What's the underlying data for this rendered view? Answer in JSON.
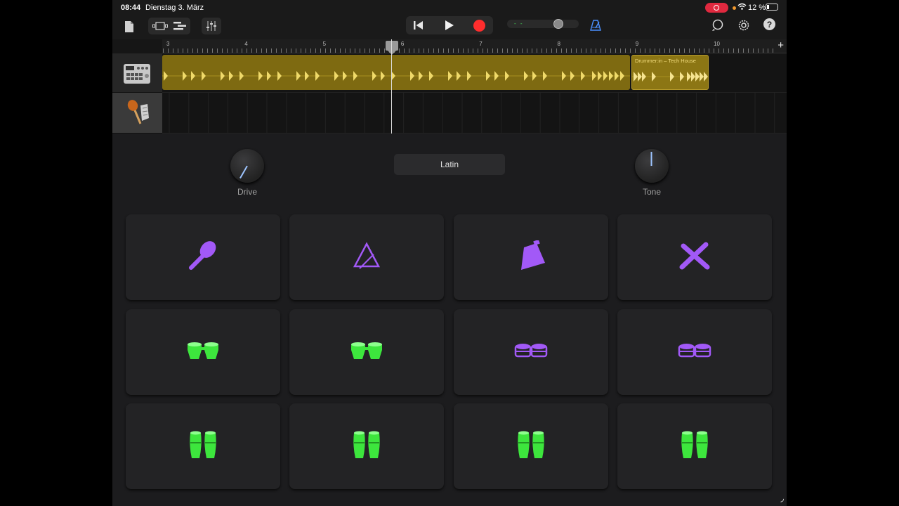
{
  "status_bar": {
    "time": "08:44",
    "date": "Dienstag 3. März",
    "battery_percent": "12 %"
  },
  "toolbar": {
    "lcd_readout": "- -"
  },
  "ruler": {
    "bars": [
      "3",
      "4",
      "5",
      "6",
      "7",
      "8",
      "9",
      "10"
    ],
    "add_label": "+"
  },
  "tracks": [
    {
      "name": "drum-machine",
      "icon": "drum-machine-icon",
      "selected": false
    },
    {
      "name": "percussion",
      "icon": "maracas-icon",
      "selected": true
    }
  ],
  "regions": {
    "second_label": "Drummer:in – Tech House"
  },
  "instrument": {
    "drive_label": "Drive",
    "tone_label": "Tone",
    "preset_label": "Latin"
  },
  "pads": [
    {
      "icon": "maraca-icon",
      "color": "#a259f7"
    },
    {
      "icon": "triangle-icon",
      "color": "#a259f7"
    },
    {
      "icon": "cowbell-icon",
      "color": "#a259f7"
    },
    {
      "icon": "claves-icon",
      "color": "#a259f7"
    },
    {
      "icon": "bongos-icon",
      "color": "#3de63d"
    },
    {
      "icon": "bongos-icon",
      "color": "#3de63d"
    },
    {
      "icon": "timbales-icon",
      "color": "#a259f7"
    },
    {
      "icon": "timbales-icon",
      "color": "#a259f7"
    },
    {
      "icon": "congas-icon",
      "color": "#3de63d"
    },
    {
      "icon": "congas-icon",
      "color": "#3de63d"
    },
    {
      "icon": "congas-icon",
      "color": "#3de63d"
    },
    {
      "icon": "congas-icon",
      "color": "#3de63d"
    }
  ],
  "colors": {
    "accent_purple": "#a259f7",
    "accent_green": "#3de63d",
    "region": "#7e6a11",
    "record": "#ff2d2d"
  }
}
